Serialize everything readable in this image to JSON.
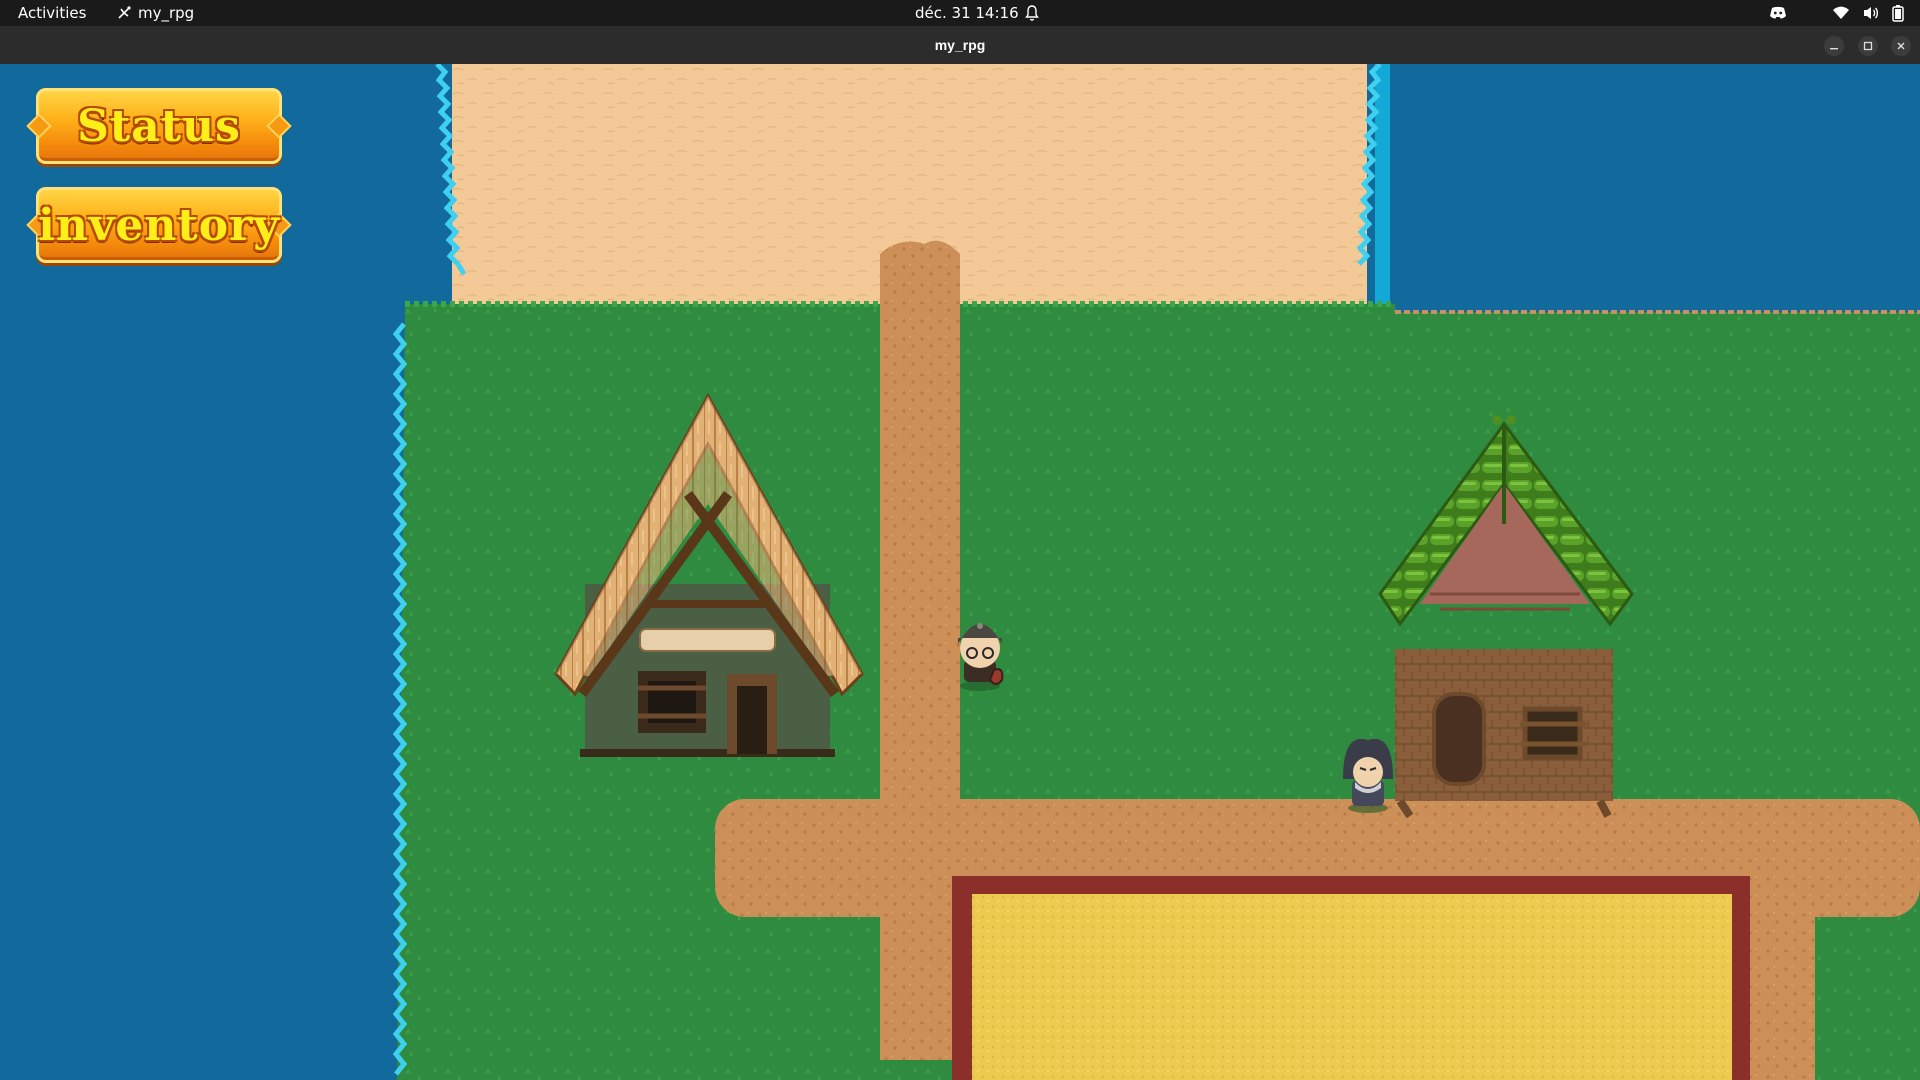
{
  "topbar": {
    "activities_label": "Activities",
    "app_name": "my_rpg",
    "clock": "déc. 31  14:16"
  },
  "window": {
    "title": "my_rpg"
  },
  "hud": {
    "status_label": "Status",
    "inventory_label": "inventory"
  },
  "icons": {
    "app": "app-icon",
    "bell": "bell-icon",
    "discord": "discord-icon",
    "wifi": "wifi-icon",
    "volume": "volume-icon",
    "battery": "battery-icon",
    "minimize": "minimize-icon",
    "maximize": "maximize-icon",
    "close": "close-icon"
  },
  "colors": {
    "water": "#116a9b",
    "grass": "#2e8a3e",
    "sand": "#f1c593",
    "path": "#c98b54",
    "wheat": "#e9c74c",
    "button": "#ffb21a"
  }
}
